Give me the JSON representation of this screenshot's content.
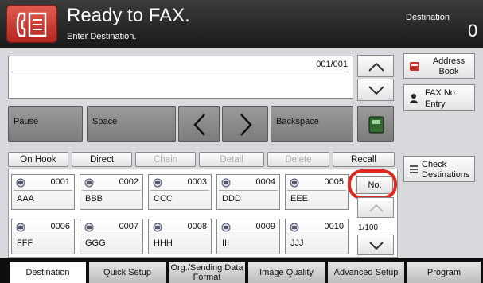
{
  "header": {
    "title": "Ready to FAX.",
    "subtitle": "Enter Destination.",
    "destination_label": "Destination",
    "destination_count": "0"
  },
  "entry": {
    "counter": "001/001"
  },
  "keypad": {
    "pause": "Pause",
    "space": "Space",
    "backspace": "Backspace"
  },
  "side": {
    "address_book": "Address Book",
    "fax_no_entry": "FAX No. Entry",
    "check_destinations": "Check Destinations"
  },
  "functions": {
    "on_hook": "On Hook",
    "direct": "Direct",
    "chain": "Chain",
    "detail": "Detail",
    "delete": "Delete",
    "recall": "Recall"
  },
  "destinations": [
    {
      "num": "0001",
      "name": "AAA"
    },
    {
      "num": "0002",
      "name": "BBB"
    },
    {
      "num": "0003",
      "name": "CCC"
    },
    {
      "num": "0004",
      "name": "DDD"
    },
    {
      "num": "0005",
      "name": "EEE"
    },
    {
      "num": "0006",
      "name": "FFF"
    },
    {
      "num": "0007",
      "name": "GGG"
    },
    {
      "num": "0008",
      "name": "HHH"
    },
    {
      "num": "0009",
      "name": "III"
    },
    {
      "num": "0010",
      "name": "JJJ"
    }
  ],
  "number_button": "No.",
  "page_indicator": "1/100",
  "tabs": [
    {
      "label": "Destination"
    },
    {
      "label": "Quick Setup"
    },
    {
      "label": "Org./Sending Data Format"
    },
    {
      "label": "Image Quality"
    },
    {
      "label": "Advanced Setup"
    },
    {
      "label": "Program"
    }
  ],
  "colors": {
    "accent": "#e1271e",
    "header": "#2a2a2a"
  }
}
